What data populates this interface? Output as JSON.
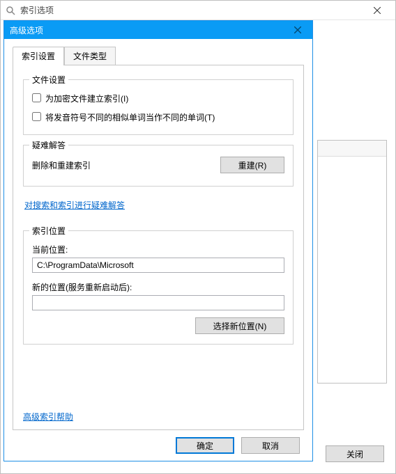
{
  "parent_window": {
    "title": "索引选项",
    "close_button_label": "关闭"
  },
  "child_window": {
    "title": "高级选项",
    "tabs": {
      "index_settings": "索引设置",
      "file_types": "文件类型"
    },
    "file_settings": {
      "legend": "文件设置",
      "checkbox_encrypt": "为加密文件建立索引(I)",
      "checkbox_diacritics": "将发音符号不同的相似单词当作不同的单词(T)"
    },
    "troubleshoot": {
      "legend": "疑难解答",
      "delete_rebuild_label": "删除和重建索引",
      "rebuild_button": "重建(R)",
      "link": "对搜索和索引进行疑难解答"
    },
    "index_location": {
      "legend": "索引位置",
      "current_label": "当前位置:",
      "current_value": "C:\\ProgramData\\Microsoft",
      "new_label": "新的位置(服务重新启动后):",
      "new_value": "",
      "select_new_button": "选择新位置(N)"
    },
    "help_link": "高级索引帮助",
    "ok_button": "确定",
    "cancel_button": "取消"
  }
}
